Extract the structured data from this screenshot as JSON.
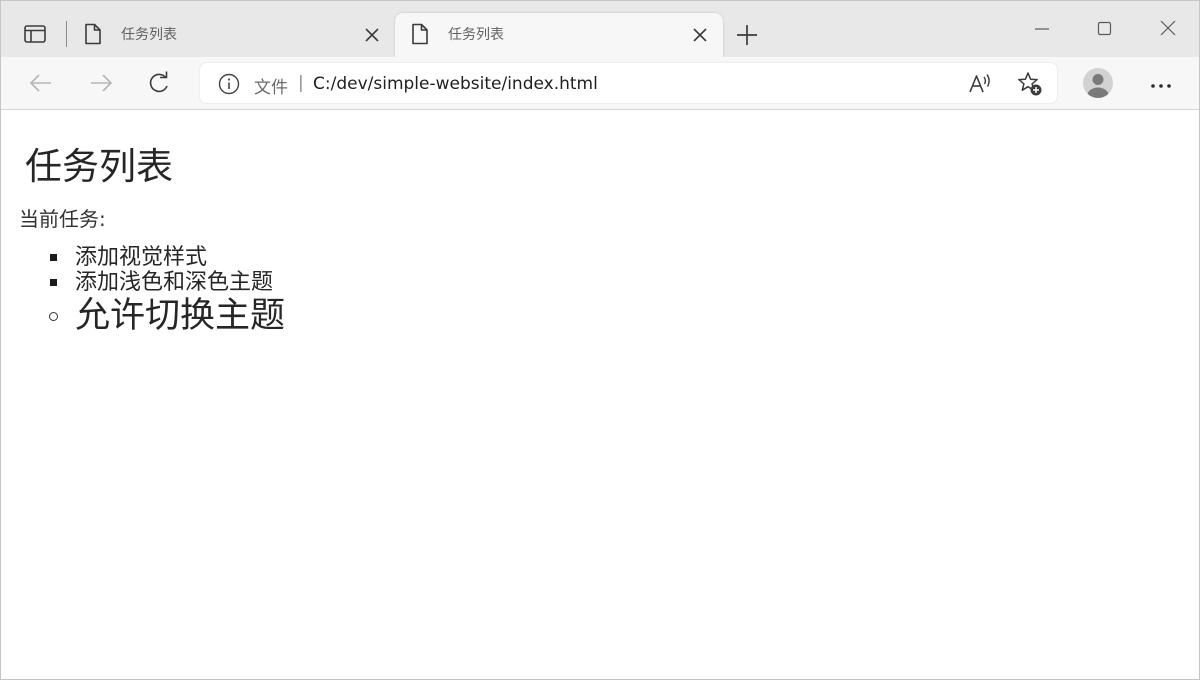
{
  "browser": {
    "tabs": [
      {
        "title": "任务列表",
        "active": false
      },
      {
        "title": "任务列表",
        "active": true
      }
    ],
    "address_bar": {
      "scheme_label": "文件",
      "separator": "|",
      "url": "C:/dev/simple-website/index.html"
    },
    "icons": {
      "tab_actions": "tab-actions-icon",
      "page": "page-icon",
      "close": "close-icon",
      "new_tab": "plus-icon",
      "minimize": "minimize-icon",
      "maximize": "maximize-icon",
      "window_close": "close-icon",
      "back": "arrow-left-icon",
      "forward": "arrow-right-icon",
      "refresh": "refresh-icon",
      "info": "info-icon",
      "read_aloud": "read-aloud-icon",
      "favorites": "add-favorite-icon",
      "profile": "avatar-icon",
      "more": "more-icon"
    },
    "colors": {
      "tabstrip": "#e8e8e8",
      "toolbar": "#f7f7f7",
      "icon": "#3b3b3b",
      "icon_disabled": "#b5b5b5"
    }
  },
  "page": {
    "title": "任务列表",
    "intro": "当前任务:",
    "tasks": [
      {
        "text": "添加视觉样式",
        "status": "done"
      },
      {
        "text": "添加浅色和深色主题",
        "status": "done"
      },
      {
        "text": "允许切换主题",
        "status": "current"
      }
    ]
  }
}
